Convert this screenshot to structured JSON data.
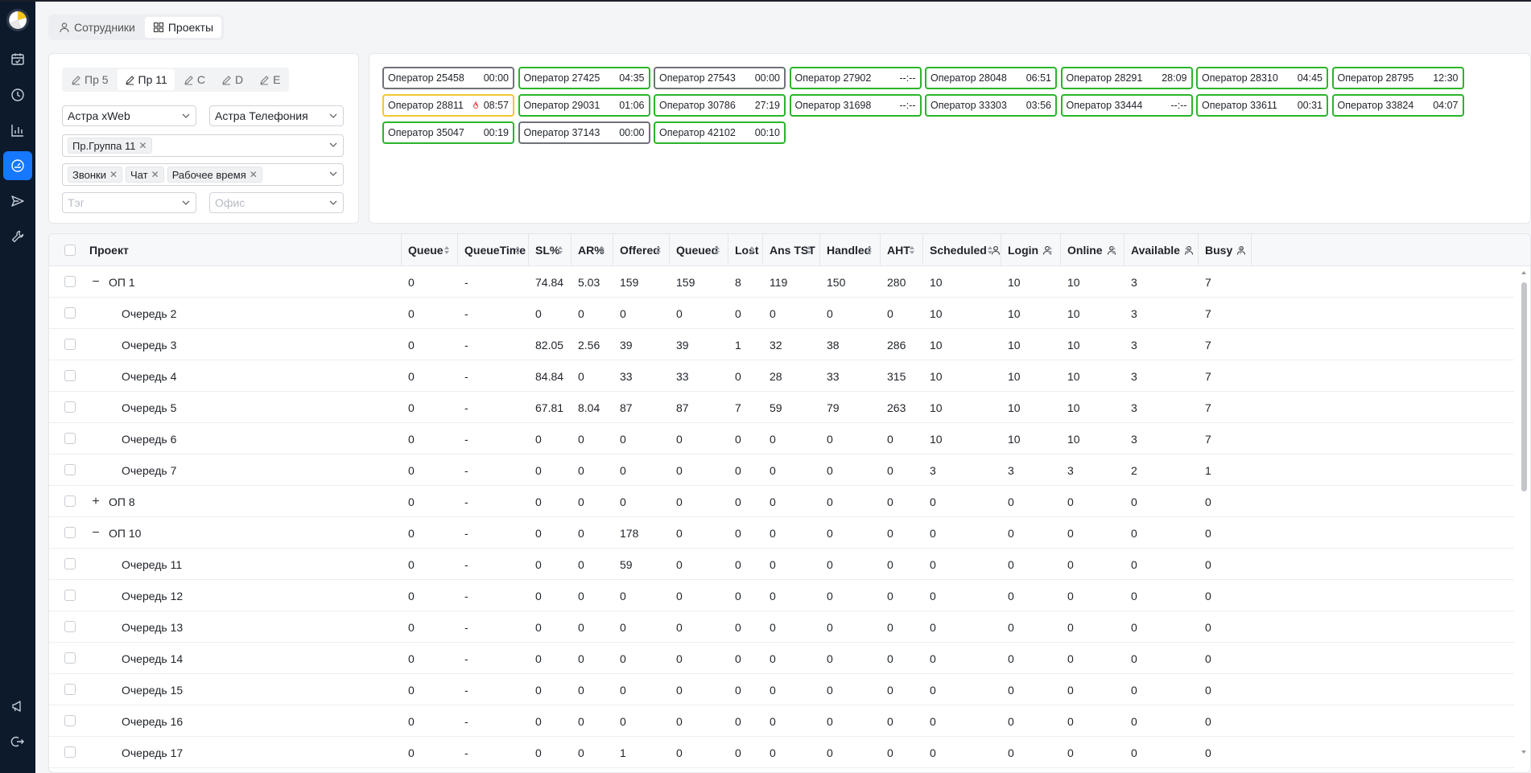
{
  "top_tabs": [
    {
      "label": "Сотрудники",
      "icon": "user-icon",
      "active": false
    },
    {
      "label": "Проекты",
      "icon": "grid-icon",
      "active": true
    }
  ],
  "filter_tabs": [
    {
      "label": "Пр 5",
      "active": false
    },
    {
      "label": "Пр 11",
      "active": true
    },
    {
      "label": "C",
      "active": false
    },
    {
      "label": "D",
      "active": false
    },
    {
      "label": "E",
      "active": false
    }
  ],
  "filters": {
    "platform": "Астра xWeb",
    "telephony": "Астра Телефония",
    "group_tags": [
      "Пр.Группа 11"
    ],
    "channel_tags": [
      "Звонки",
      "Чат",
      "Рабочее время"
    ],
    "tag_placeholder": "Тэг",
    "office_placeholder": "Офис"
  },
  "operators": [
    {
      "name": "Оператор 25458",
      "time": "00:00",
      "status": "gray"
    },
    {
      "name": "Оператор 27425",
      "time": "04:35",
      "status": "green"
    },
    {
      "name": "Оператор 27543",
      "time": "00:00",
      "status": "gray"
    },
    {
      "name": "Оператор 27902",
      "time": "--:--",
      "status": "green"
    },
    {
      "name": "Оператор 28048",
      "time": "06:51",
      "status": "green"
    },
    {
      "name": "Оператор 28291",
      "time": "28:09",
      "status": "green"
    },
    {
      "name": "Оператор 28310",
      "time": "04:45",
      "status": "green"
    },
    {
      "name": "Оператор 28795",
      "time": "12:30",
      "status": "green"
    },
    {
      "name": "Оператор 28811",
      "time": "08:57",
      "status": "yellow",
      "icon": "fire-icon"
    },
    {
      "name": "Оператор 29031",
      "time": "01:06",
      "status": "green"
    },
    {
      "name": "Оператор 30786",
      "time": "27:19",
      "status": "green"
    },
    {
      "name": "Оператор 31698",
      "time": "--:--",
      "status": "green"
    },
    {
      "name": "Оператор 33303",
      "time": "03:56",
      "status": "green"
    },
    {
      "name": "Оператор 33444",
      "time": "--:--",
      "status": "green"
    },
    {
      "name": "Оператор 33611",
      "time": "00:31",
      "status": "green"
    },
    {
      "name": "Оператор 33824",
      "time": "04:07",
      "status": "green"
    },
    {
      "name": "Оператор 35047",
      "time": "00:19",
      "status": "green"
    },
    {
      "name": "Оператор 37143",
      "time": "00:00",
      "status": "gray"
    },
    {
      "name": "Оператор 42102",
      "time": "00:10",
      "status": "green"
    }
  ],
  "table": {
    "columns": [
      "Проект",
      "Queue",
      "QueueTime",
      "SL%",
      "AR%",
      "Offered",
      "Queued",
      "Lost",
      "Ans TST",
      "Handled",
      "AHT",
      "Scheduled",
      "Login",
      "Online",
      "Available",
      "Busy"
    ],
    "person_icon_columns": [
      "Scheduled",
      "Login",
      "Online",
      "Available",
      "Busy"
    ],
    "rows": [
      {
        "name": "ОП 1",
        "level": 0,
        "expander": "−",
        "values": [
          "0",
          "-",
          "74.84",
          "5.03",
          "159",
          "159",
          "8",
          "119",
          "150",
          "280",
          "10",
          "10",
          "10",
          "3",
          "7"
        ]
      },
      {
        "name": "Очередь 2",
        "level": 1,
        "values": [
          "0",
          "-",
          "0",
          "0",
          "0",
          "0",
          "0",
          "0",
          "0",
          "0",
          "10",
          "10",
          "10",
          "3",
          "7"
        ]
      },
      {
        "name": "Очередь 3",
        "level": 1,
        "values": [
          "0",
          "-",
          "82.05",
          "2.56",
          "39",
          "39",
          "1",
          "32",
          "38",
          "286",
          "10",
          "10",
          "10",
          "3",
          "7"
        ]
      },
      {
        "name": "Очередь 4",
        "level": 1,
        "values": [
          "0",
          "-",
          "84.84",
          "0",
          "33",
          "33",
          "0",
          "28",
          "33",
          "315",
          "10",
          "10",
          "10",
          "3",
          "7"
        ]
      },
      {
        "name": "Очередь 5",
        "level": 1,
        "values": [
          "0",
          "-",
          "67.81",
          "8.04",
          "87",
          "87",
          "7",
          "59",
          "79",
          "263",
          "10",
          "10",
          "10",
          "3",
          "7"
        ]
      },
      {
        "name": "Очередь 6",
        "level": 1,
        "values": [
          "0",
          "-",
          "0",
          "0",
          "0",
          "0",
          "0",
          "0",
          "0",
          "0",
          "10",
          "10",
          "10",
          "3",
          "7"
        ]
      },
      {
        "name": "Очередь 7",
        "level": 1,
        "values": [
          "0",
          "-",
          "0",
          "0",
          "0",
          "0",
          "0",
          "0",
          "0",
          "0",
          "3",
          "3",
          "3",
          "2",
          "1"
        ]
      },
      {
        "name": "ОП 8",
        "level": 0,
        "expander": "+",
        "values": [
          "0",
          "-",
          "0",
          "0",
          "0",
          "0",
          "0",
          "0",
          "0",
          "0",
          "0",
          "0",
          "0",
          "0",
          "0"
        ]
      },
      {
        "name": "ОП 10",
        "level": 0,
        "expander": "−",
        "values": [
          "0",
          "-",
          "0",
          "0",
          "178",
          "0",
          "0",
          "0",
          "0",
          "0",
          "0",
          "0",
          "0",
          "0",
          "0"
        ]
      },
      {
        "name": "Очередь 11",
        "level": 1,
        "values": [
          "0",
          "-",
          "0",
          "0",
          "59",
          "0",
          "0",
          "0",
          "0",
          "0",
          "0",
          "0",
          "0",
          "0",
          "0"
        ]
      },
      {
        "name": "Очередь 12",
        "level": 1,
        "values": [
          "0",
          "-",
          "0",
          "0",
          "0",
          "0",
          "0",
          "0",
          "0",
          "0",
          "0",
          "0",
          "0",
          "0",
          "0"
        ]
      },
      {
        "name": "Очередь 13",
        "level": 1,
        "values": [
          "0",
          "-",
          "0",
          "0",
          "0",
          "0",
          "0",
          "0",
          "0",
          "0",
          "0",
          "0",
          "0",
          "0",
          "0"
        ]
      },
      {
        "name": "Очередь 14",
        "level": 1,
        "values": [
          "0",
          "-",
          "0",
          "0",
          "0",
          "0",
          "0",
          "0",
          "0",
          "0",
          "0",
          "0",
          "0",
          "0",
          "0"
        ]
      },
      {
        "name": "Очередь 15",
        "level": 1,
        "values": [
          "0",
          "-",
          "0",
          "0",
          "0",
          "0",
          "0",
          "0",
          "0",
          "0",
          "0",
          "0",
          "0",
          "0",
          "0"
        ]
      },
      {
        "name": "Очередь 16",
        "level": 1,
        "values": [
          "0",
          "-",
          "0",
          "0",
          "0",
          "0",
          "0",
          "0",
          "0",
          "0",
          "0",
          "0",
          "0",
          "0",
          "0"
        ]
      },
      {
        "name": "Очередь 17",
        "level": 1,
        "values": [
          "0",
          "-",
          "0",
          "0",
          "1",
          "0",
          "0",
          "0",
          "0",
          "0",
          "0",
          "0",
          "0",
          "0",
          "0"
        ]
      }
    ]
  },
  "colors": {
    "accent": "#1677ff",
    "sidebar": "#0d1a2b",
    "green": "#2ab52a",
    "yellow": "#f0c832",
    "gray": "#6f7378"
  }
}
